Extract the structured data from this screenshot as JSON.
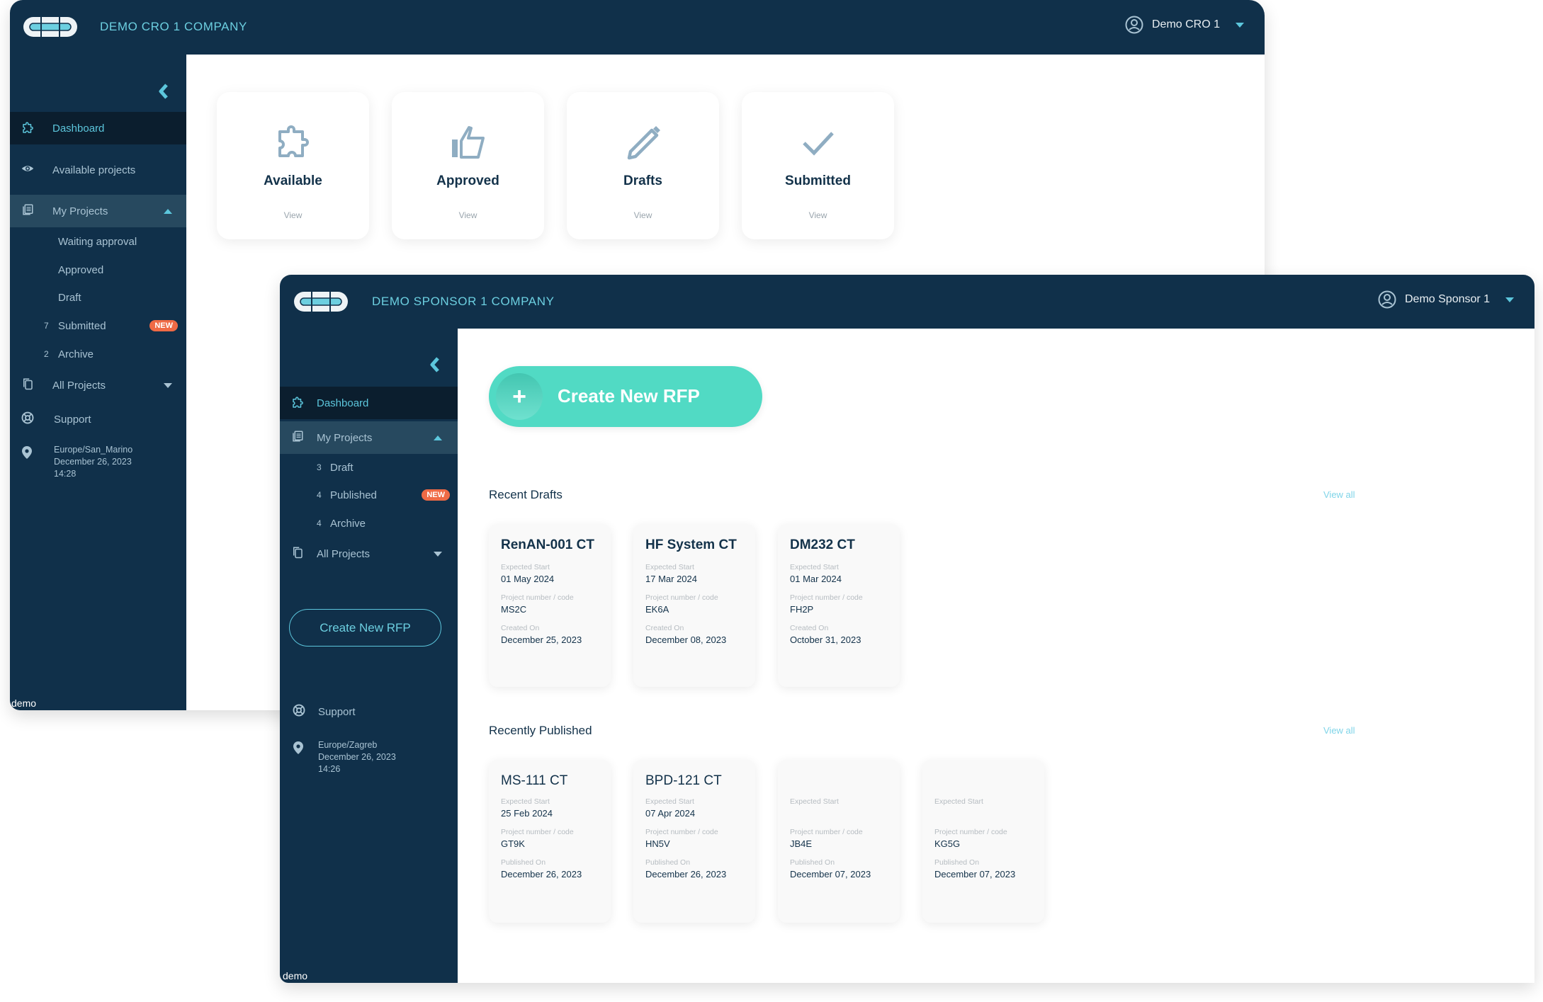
{
  "back_window": {
    "company": "DEMO CRO 1 COMPANY",
    "user_name": "Demo CRO 1",
    "sidebar": {
      "items": [
        {
          "label": "Dashboard",
          "icon": "puzzle-icon"
        },
        {
          "label": "Available projects",
          "icon": "eye-icon"
        },
        {
          "label": "My Projects",
          "icon": "stack-icon"
        },
        {
          "label": "All Projects",
          "icon": "copy-icon"
        },
        {
          "label": "Support",
          "icon": "lifebuoy-icon"
        }
      ],
      "my_projects_sub": [
        {
          "count": "",
          "label": "Waiting approval",
          "badge": ""
        },
        {
          "count": "",
          "label": "Approved",
          "badge": ""
        },
        {
          "count": "",
          "label": "Draft",
          "badge": ""
        },
        {
          "count": "7",
          "label": "Submitted",
          "badge": "NEW"
        },
        {
          "count": "2",
          "label": "Archive",
          "badge": ""
        }
      ],
      "location": {
        "timezone": "Europe/San_Marino",
        "date": "December 26, 2023",
        "time": "14:28"
      },
      "footer_label": "demo"
    },
    "status_cards": [
      {
        "title": "Available",
        "link": "View",
        "icon": "puzzle-icon"
      },
      {
        "title": "Approved",
        "link": "View",
        "icon": "thumbs-up-icon"
      },
      {
        "title": "Drafts",
        "link": "View",
        "icon": "pencil-icon"
      },
      {
        "title": "Submitted",
        "link": "View",
        "icon": "check-icon"
      }
    ]
  },
  "front_window": {
    "company": "DEMO SPONSOR 1 COMPANY",
    "user_name": "Demo Sponsor 1",
    "sidebar": {
      "items": [
        {
          "label": "Dashboard",
          "icon": "puzzle-icon"
        },
        {
          "label": "My Projects",
          "icon": "stack-icon"
        },
        {
          "label": "All Projects",
          "icon": "copy-icon"
        },
        {
          "label": "Support",
          "icon": "lifebuoy-icon"
        }
      ],
      "my_projects_sub": [
        {
          "count": "3",
          "label": "Draft",
          "badge": ""
        },
        {
          "count": "4",
          "label": "Published",
          "badge": "NEW"
        },
        {
          "count": "4",
          "label": "Archive",
          "badge": ""
        }
      ],
      "create_button": "Create New RFP",
      "location": {
        "timezone": "Europe/Zagreb",
        "date": "December 26, 2023",
        "time": "14:26"
      },
      "footer_label": "demo"
    },
    "main": {
      "create_button": "Create New RFP",
      "recent_drafts": {
        "title": "Recent Drafts",
        "view_all": "View all",
        "cards": [
          {
            "title": "RenAN-001 CT",
            "expected_start_label": "Expected Start",
            "expected_start": "01 May 2024",
            "code_label": "Project number / code",
            "code": "MS2C",
            "date_label": "Created On",
            "date": "December 25, 2023"
          },
          {
            "title": "HF System CT",
            "expected_start_label": "Expected Start",
            "expected_start": "17 Mar 2024",
            "code_label": "Project number / code",
            "code": "EK6A",
            "date_label": "Created On",
            "date": "December 08, 2023"
          },
          {
            "title": "DM232 CT",
            "expected_start_label": "Expected Start",
            "expected_start": "01 Mar 2024",
            "code_label": "Project number / code",
            "code": "FH2P",
            "date_label": "Created On",
            "date": "October 31, 2023"
          }
        ]
      },
      "recently_published": {
        "title": "Recently Published",
        "view_all": "View all",
        "cards": [
          {
            "title": "MS-111 CT",
            "expected_start_label": "Expected Start",
            "expected_start": "25 Feb 2024",
            "code_label": "Project number / code",
            "code": "GT9K",
            "date_label": "Published On",
            "date": "December 26, 2023"
          },
          {
            "title": "BPD-121 CT",
            "expected_start_label": "Expected Start",
            "expected_start": "07 Apr 2024",
            "code_label": "Project number / code",
            "code": "HN5V",
            "date_label": "Published On",
            "date": "December 26, 2023"
          },
          {
            "title": "",
            "expected_start_label": "Expected Start",
            "expected_start": "",
            "code_label": "Project number / code",
            "code": "JB4E",
            "date_label": "Published On",
            "date": "December 07, 2023"
          },
          {
            "title": "",
            "expected_start_label": "Expected Start",
            "expected_start": "",
            "code_label": "Project number / code",
            "code": "KG5G",
            "date_label": "Published On",
            "date": "December 07, 2023"
          }
        ]
      }
    }
  },
  "colors": {
    "navy": "#10304a",
    "accent_cyan": "#5cc6dc",
    "teal_button": "#51dac4",
    "badge_orange": "#ef6a45",
    "icon_gray_blue": "#8fadc2"
  }
}
